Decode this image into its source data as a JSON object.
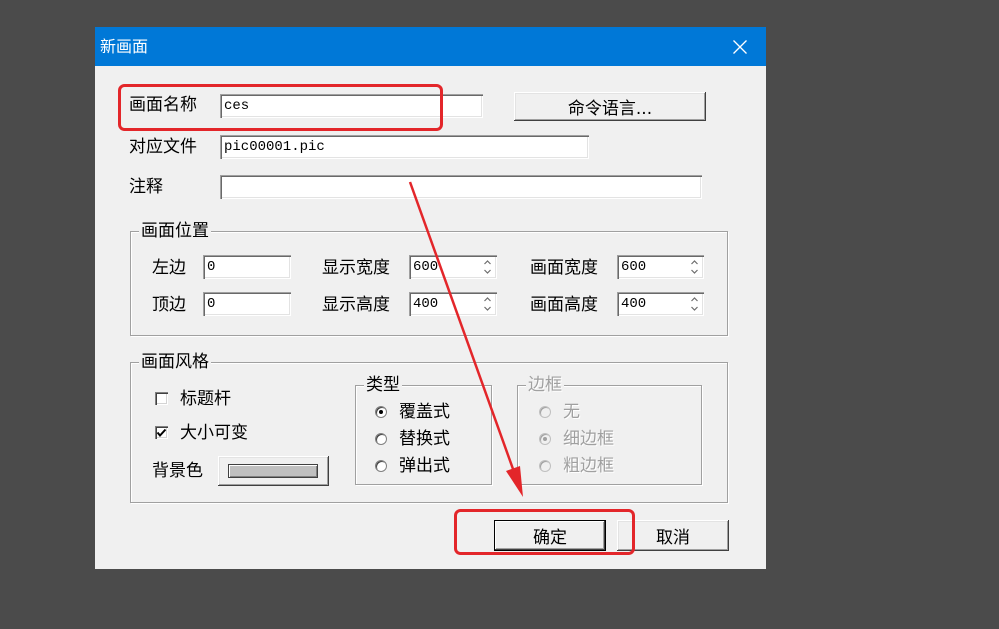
{
  "window": {
    "title": "新画面"
  },
  "form": {
    "name": {
      "label": "画面名称",
      "value": "ces"
    },
    "command_button": "命令语言...",
    "file": {
      "label": "对应文件",
      "value": "pic00001.pic"
    },
    "comment": {
      "label": "注释"
    }
  },
  "position": {
    "legend": "画面位置",
    "left": {
      "label": "左边",
      "value": "0"
    },
    "top": {
      "label": "顶边",
      "value": "0"
    },
    "display_width": {
      "label": "显示宽度",
      "value": "600"
    },
    "display_height": {
      "label": "显示高度",
      "value": "400"
    },
    "picture_width": {
      "label": "画面宽度",
      "value": "600"
    },
    "picture_height": {
      "label": "画面高度",
      "value": "400"
    }
  },
  "style": {
    "legend": "画面风格",
    "title_bar": {
      "label": "标题杆",
      "checked": false
    },
    "resizable": {
      "label": "大小可变",
      "checked": true
    },
    "background_color": {
      "label": "背景色"
    },
    "type": {
      "legend": "类型",
      "options": [
        {
          "label": "覆盖式",
          "selected": true
        },
        {
          "label": "替换式",
          "selected": false
        },
        {
          "label": "弹出式",
          "selected": false
        }
      ]
    },
    "border": {
      "legend": "边框",
      "disabled": true,
      "options": [
        {
          "label": "无",
          "selected": false
        },
        {
          "label": "细边框",
          "selected": true
        },
        {
          "label": "粗边框",
          "selected": false
        }
      ]
    }
  },
  "buttons": {
    "ok": "确定",
    "cancel": "取消"
  },
  "icons": {
    "close": "close-icon",
    "check": "check-icon",
    "spin_up": "spin-up-icon",
    "spin_down": "spin-down-icon"
  },
  "colors": {
    "page_bg": "#4b4b4b",
    "title_bar": "#0078d7",
    "dialog_bg": "#f0f0f0",
    "disabled_text": "#a0a0a0",
    "background_swatch": "#c0c0c0",
    "annotation": "#e3262a"
  }
}
